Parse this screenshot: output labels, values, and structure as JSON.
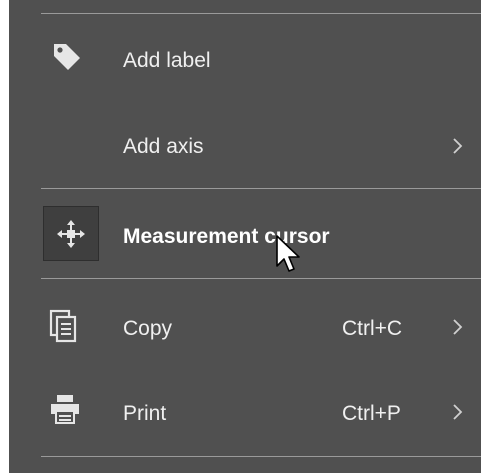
{
  "menu": {
    "items": [
      {
        "id": "add-label",
        "label": "Add label",
        "icon": "tag-icon",
        "shortcut": "",
        "has_submenu": false
      },
      {
        "id": "add-axis",
        "label": "Add axis",
        "icon": "",
        "shortcut": "",
        "has_submenu": true
      },
      {
        "id": "measurement-cursor",
        "label": "Measurement cursor",
        "icon": "crosshair-move-icon",
        "shortcut": "",
        "has_submenu": false,
        "highlighted": true
      },
      {
        "id": "copy",
        "label": "Copy",
        "icon": "copy-icon",
        "shortcut": "Ctrl+C",
        "has_submenu": true
      },
      {
        "id": "print",
        "label": "Print",
        "icon": "printer-icon",
        "shortcut": "Ctrl+P",
        "has_submenu": true
      }
    ]
  },
  "colors": {
    "menu_background": "#505050",
    "divider": "#9a9a9a",
    "text": "#f0f0f0",
    "icon": "#e6e6e6"
  }
}
